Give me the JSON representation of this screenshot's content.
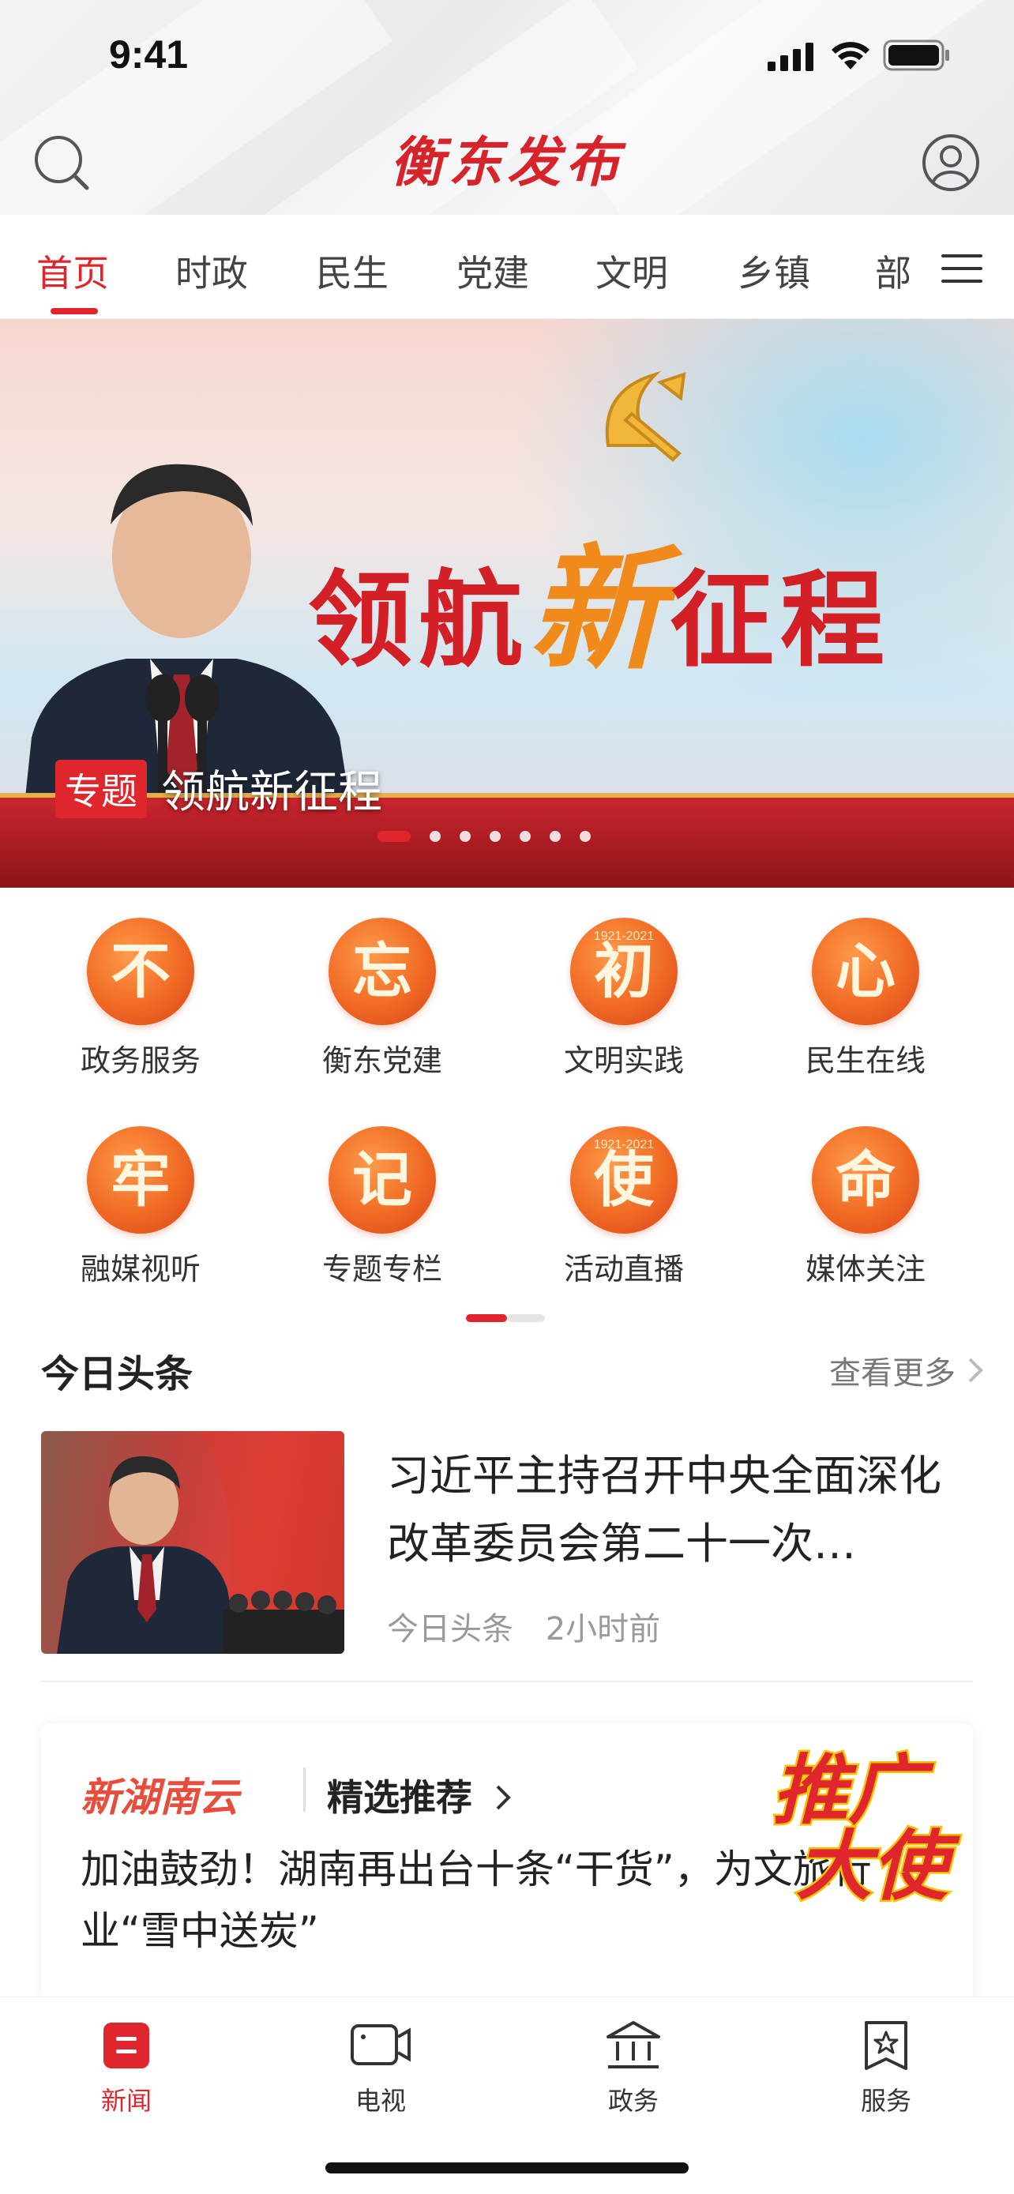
{
  "status_bar": {
    "time": "9:41"
  },
  "header": {
    "logo": "衡东发布"
  },
  "tabs": [
    {
      "label": "首页",
      "active": true
    },
    {
      "label": "时政"
    },
    {
      "label": "民生"
    },
    {
      "label": "党建"
    },
    {
      "label": "文明"
    },
    {
      "label": "乡镇"
    },
    {
      "label": "部"
    }
  ],
  "banner": {
    "headline": "领航新征程",
    "caption_tag": "专题",
    "caption_text": "领航新征程",
    "slides": 7,
    "active_slide": 1
  },
  "grid": [
    {
      "glyph": "不",
      "label": "政务服务"
    },
    {
      "glyph": "忘",
      "label": "衡东党建"
    },
    {
      "glyph": "初",
      "label": "文明实践",
      "cap": "1921-2021"
    },
    {
      "glyph": "心",
      "label": "民生在线"
    },
    {
      "glyph": "牢",
      "label": "融媒视听"
    },
    {
      "glyph": "记",
      "label": "专题专栏"
    },
    {
      "glyph": "使",
      "label": "活动直播",
      "cap": "1921-2021"
    },
    {
      "glyph": "命",
      "label": "媒体关注"
    }
  ],
  "headlines": {
    "section_title": "今日头条",
    "more": "查看更多",
    "item": {
      "title": "习近平主持召开中央全面深化改革委员会第二十一次…",
      "source": "今日头条",
      "time": "2小时前"
    }
  },
  "recommend": {
    "brand": "新湖南云",
    "label": "精选推荐",
    "text": "加油鼓劲！湖南再出台十条“干货”，为文旅行业“雪中送炭”",
    "badge": "推广大使"
  },
  "bottom_nav": [
    {
      "label": "新闻",
      "icon": "news-icon",
      "active": true
    },
    {
      "label": "电视",
      "icon": "tv-icon"
    },
    {
      "label": "政务",
      "icon": "government-icon"
    },
    {
      "label": "服务",
      "icon": "service-icon"
    }
  ],
  "colors": {
    "accent": "#e0262d",
    "icon_orange": "#f06a24"
  }
}
